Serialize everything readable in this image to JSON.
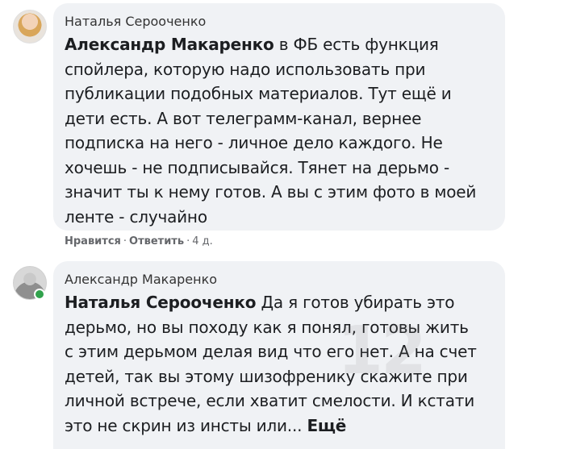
{
  "comment1": {
    "author": "Наталья Серооченко",
    "mention": "Александр Макаренко",
    "lines": [
      " в ФБ есть функция",
      "спойлера, которую надо использовать при",
      "публикации подобных материалов. Тут ещё и",
      "дети есть. А вот телеграмм-канал, вернее",
      "подписка на него - личное дело каждого. Не",
      "хочешь - не подписывайся. Тянет на дерьмо -",
      "значит ты к нему готов. А вы с этим фото в моей",
      "ленте - случайно"
    ],
    "actions": {
      "like": "Нравится",
      "sep": "·",
      "reply": "Ответить",
      "time": "4 д."
    }
  },
  "comment2": {
    "author": "Александр Макаренко",
    "mention": "Наталья Серооченко",
    "lines": [
      " Да я готов убирать это",
      "дерьмо, но вы походу как я понял, готовы жить",
      "с этим дерьмом делая вид что его нет. А на счет",
      "детей, так вы этому шизофренику скажите при",
      "личной встрече, если хватит смелости. И кстати",
      "это не скрин из инсты или... "
    ],
    "more_label": "Ещё"
  },
  "watermark": "12"
}
